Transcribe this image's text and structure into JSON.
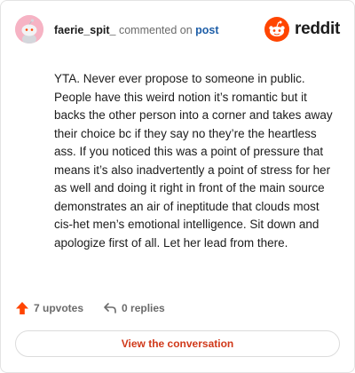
{
  "header": {
    "username": "faerie_spit_",
    "action_text": "commented on",
    "post_link": "post",
    "brand_word": "reddit",
    "avatar_icon": "snoo-avatar-icon",
    "brand_icon": "reddit-logo-icon"
  },
  "comment": {
    "body": "YTA. Never ever propose to someone in public. People have this weird notion it’s romantic but it backs the other person into a corner and takes away their choice bc if they say no they’re the heartless ass. If you noticed this was a point of pressure that means it’s also inadvertently a point of stress for her as well and doing it right in front of the main source demonstrates an air of ineptitude that clouds most cis-het men’s emotional intelligence. Sit down and apologize first of all. Let her lead from there."
  },
  "actions": {
    "upvotes_label": "7 upvotes",
    "replies_label": "0 replies",
    "upvote_icon": "upvote-arrow-icon",
    "reply_icon": "reply-arrow-icon"
  },
  "cta": {
    "label": "View the conversation"
  },
  "colors": {
    "accent": "#ff4500",
    "link": "#1f5fa8",
    "cta_text": "#d0391a",
    "avatar_bg": "#f6b3c4"
  }
}
